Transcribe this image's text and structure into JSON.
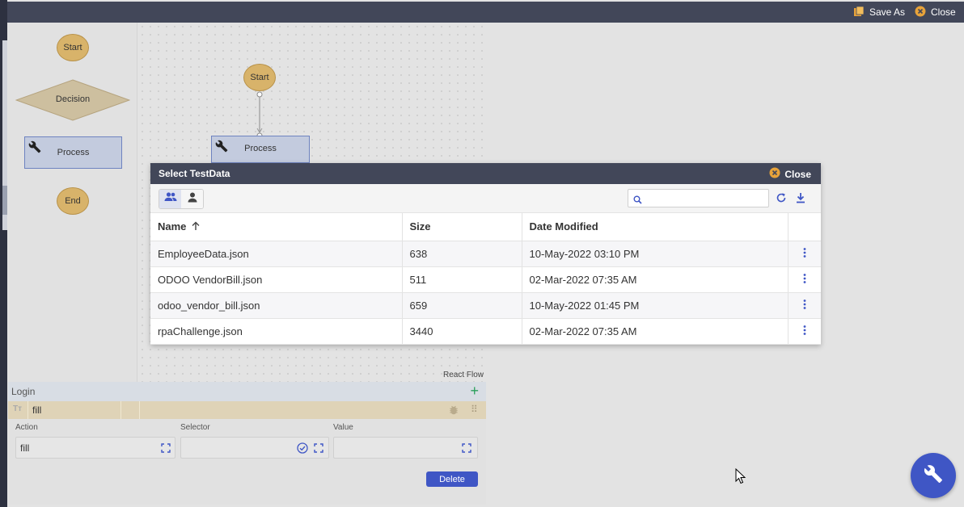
{
  "topbar": {
    "save_as_label": "Save As",
    "close_label": "Close"
  },
  "palette": {
    "start": "Start",
    "decision": "Decision",
    "process": "Process",
    "end": "End"
  },
  "canvas": {
    "start_node": "Start",
    "process_node": "Process",
    "watermark": "React Flow"
  },
  "modal": {
    "title": "Select TestData",
    "close_label": "Close",
    "search_placeholder": "",
    "columns": {
      "name": "Name",
      "size": "Size",
      "date": "Date Modified"
    },
    "rows": [
      {
        "name": "EmployeeData.json",
        "size": "638",
        "date": "10-May-2022 03:10 PM"
      },
      {
        "name": "ODOO VendorBill.json",
        "size": "511",
        "date": "02-Mar-2022 07:35 AM"
      },
      {
        "name": "odoo_vendor_bill.json",
        "size": "659",
        "date": "10-May-2022 01:45 PM"
      },
      {
        "name": "rpaChallenge.json",
        "size": "3440",
        "date": "02-Mar-2022 07:35 AM"
      }
    ]
  },
  "properties": {
    "section_title": "Login",
    "step_label": "fill",
    "action_label": "Action",
    "action_value": "fill",
    "selector_label": "Selector",
    "selector_value": "",
    "value_label": "Value",
    "value_value": "",
    "delete_label": "Delete"
  },
  "colors": {
    "accent": "#3f56c5",
    "header": "#424759",
    "node": "#d8b36a",
    "process": "#c3cbde",
    "close_icon": "#e8a33a"
  },
  "icons": [
    "save-as-icon",
    "close-icon",
    "wrench-icon",
    "group-icon",
    "person-icon",
    "search-icon",
    "refresh-icon",
    "download-icon",
    "sort-up-icon",
    "more-vert-icon",
    "expand-icon",
    "check-circle-icon",
    "plus-icon",
    "text-type-icon",
    "bug-icon",
    "drag-icon"
  ]
}
